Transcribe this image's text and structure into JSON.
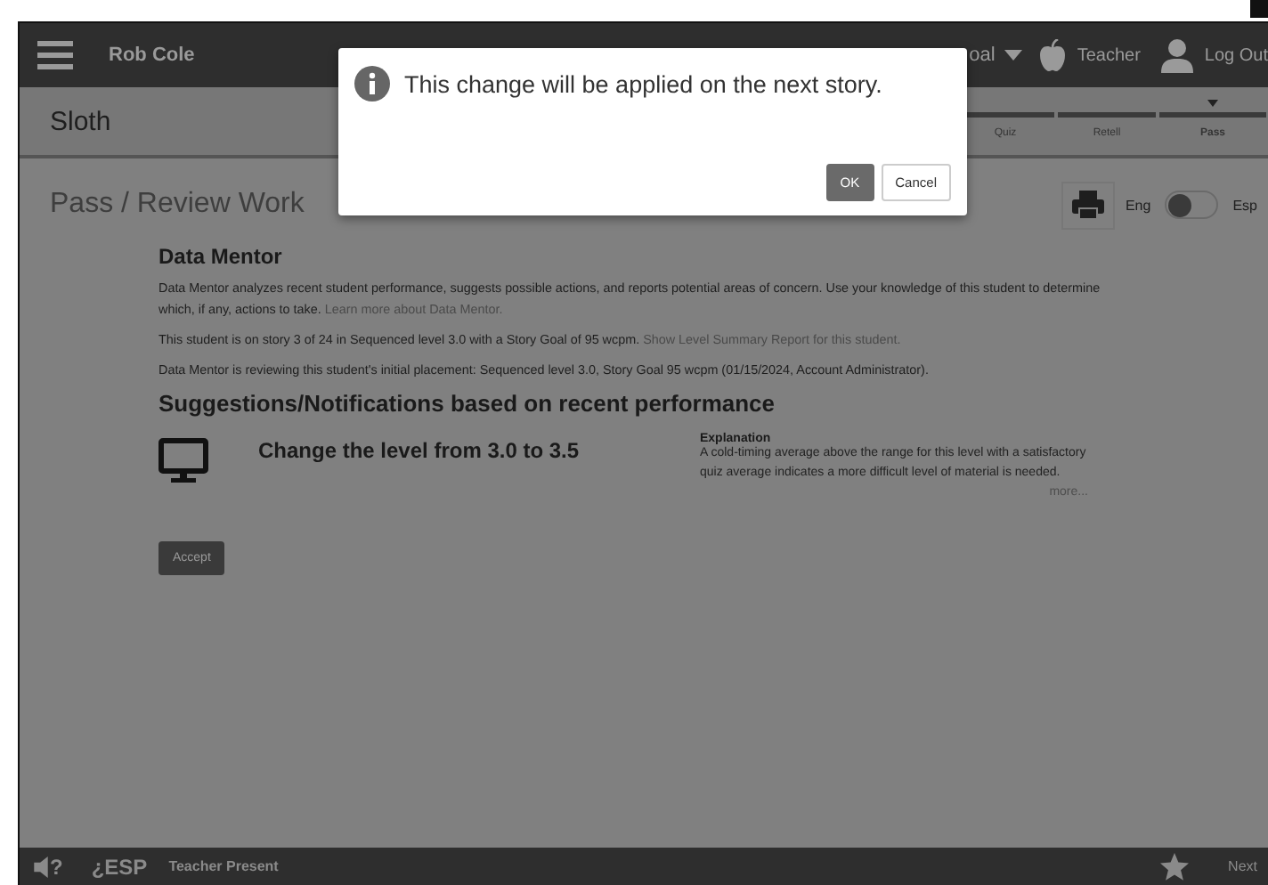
{
  "top_bar": {
    "user": "Rob Cole",
    "level_goal": "oal",
    "teacher": "Teacher",
    "logout": "Log Out"
  },
  "story_bar": {
    "title": "Sloth",
    "tabs": [
      {
        "label": "Quiz",
        "selected": false
      },
      {
        "label": "Retell",
        "selected": false
      },
      {
        "label": "Pass",
        "selected": true
      }
    ]
  },
  "page": {
    "title": "Pass / Review Work",
    "language": {
      "left": "Eng",
      "right": "Esp",
      "right_on": false
    }
  },
  "data_mentor": {
    "heading": "Data Mentor",
    "intro": "Data Mentor analyzes recent student performance, suggests possible actions, and reports potential areas of concern. Use your knowledge of this student to determine which, if any, actions to take.",
    "intro_link": "Learn more about Data Mentor.",
    "story_info": "This student is on story 3 of 24 in Sequenced level 3.0 with a Story Goal of 95 wcpm.",
    "story_link": "Show Level Summary Report for this student.",
    "placement": "Data Mentor is reviewing this student's initial placement: Sequenced level 3.0, Story Goal 95 wcpm (01/15/2024, Account Administrator)."
  },
  "suggestions": {
    "heading": "Suggestions/Notifications based on recent performance",
    "items": [
      {
        "title": "Change the level from 3.0 to 3.5",
        "explanation_label": "Explanation",
        "explanation": "A cold-timing average above the range for this level with a satisfactory quiz average indicates a more difficult level of material is needed.",
        "more": "more..."
      }
    ],
    "accept": "Accept"
  },
  "dialog": {
    "message": "This change will be applied on the next story.",
    "buttons": [
      "OK",
      "Cancel"
    ]
  },
  "bottom_bar": {
    "help_mark": "?",
    "esp": "¿ESP",
    "teacher_present": "Teacher Present",
    "next": "Next"
  }
}
